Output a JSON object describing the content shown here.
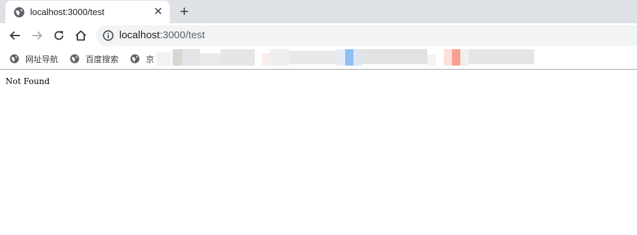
{
  "tab": {
    "title": "localhost:3000/test",
    "favicon": "globe-icon"
  },
  "toolbar": {
    "back_icon": "back-arrow-icon",
    "forward_icon": "forward-arrow-icon",
    "reload_icon": "reload-icon",
    "home_icon": "home-icon"
  },
  "omnibox": {
    "url_host": "localhost",
    "url_rest": ":3000/test",
    "info_icon": "info-icon"
  },
  "bookmarks": [
    {
      "label": "网址导航",
      "icon": "globe-icon"
    },
    {
      "label": "百度搜索",
      "icon": "globe-icon"
    },
    {
      "label": "京",
      "icon": "globe-icon"
    }
  ],
  "page": {
    "message": "Not Found"
  },
  "colors": {
    "tabstrip_bg": "#dee1e6",
    "omnibox_bg": "#f1f3f4",
    "icon_color": "#5f6368"
  }
}
